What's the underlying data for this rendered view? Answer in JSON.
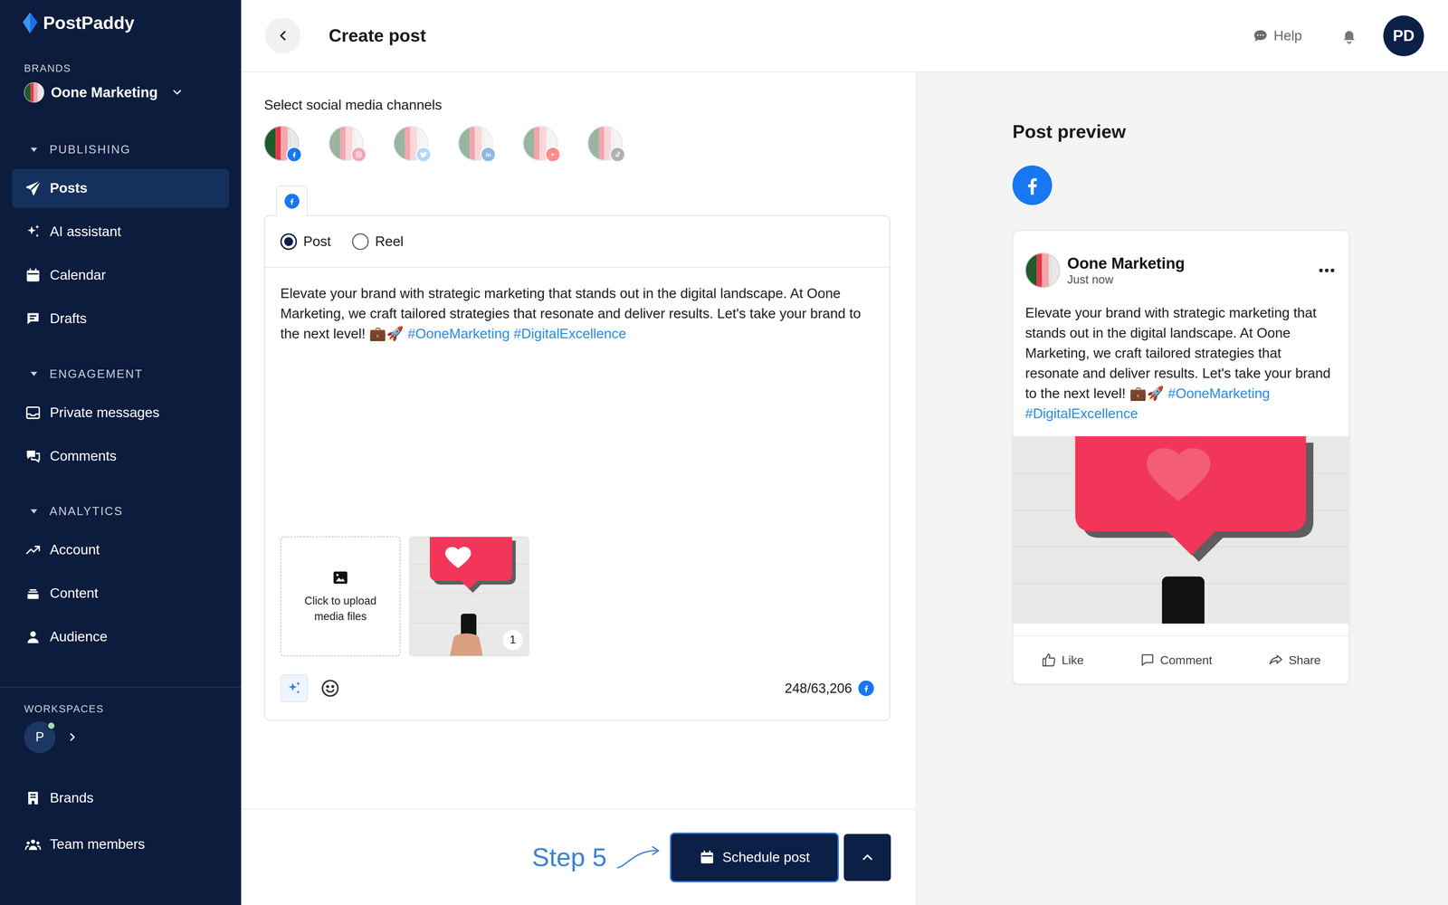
{
  "sidebar": {
    "logo": "PostPaddy",
    "brands_label": "BRANDS",
    "brand": "Oone Marketing",
    "sections": [
      {
        "title": "PUBLISHING",
        "expanded": true,
        "items": [
          {
            "label": "Posts",
            "selected": true
          },
          {
            "label": "AI assistant",
            "selected": false
          },
          {
            "label": "Calendar",
            "selected": false
          },
          {
            "label": "Drafts",
            "selected": false
          }
        ]
      },
      {
        "title": "ENGAGEMENT",
        "expanded": true,
        "items": [
          {
            "label": "Private messages",
            "selected": false
          },
          {
            "label": "Comments",
            "selected": false
          }
        ]
      },
      {
        "title": "ANALYTICS",
        "expanded": true,
        "items": [
          {
            "label": "Account",
            "selected": false
          },
          {
            "label": "Content",
            "selected": false
          },
          {
            "label": "Audience",
            "selected": false
          }
        ]
      }
    ],
    "workspaces_label": "WORKSPACES",
    "workspace": {
      "initial": "P",
      "online": true
    },
    "bottom_items": [
      {
        "label": "Brands",
        "selected": false
      },
      {
        "label": "Team members",
        "selected": false
      }
    ]
  },
  "header": {
    "title": "Create post",
    "help": "Help",
    "avatar": "PD"
  },
  "channels": {
    "label": "Select social media channels",
    "items": [
      {
        "kind": "facebook",
        "selected": true,
        "color": "#1877f2"
      },
      {
        "kind": "instagram",
        "selected": false,
        "color": "#e4405f"
      },
      {
        "kind": "twitter",
        "selected": false,
        "color": "#55acee"
      },
      {
        "kind": "linkedin",
        "selected": false,
        "color": "#0a66c2"
      },
      {
        "kind": "youtube",
        "selected": false,
        "color": "#ff0000"
      },
      {
        "kind": "tiktok",
        "selected": false,
        "color": "#555555"
      }
    ]
  },
  "editor": {
    "tabs": [
      {
        "kind": "facebook",
        "selected": true
      }
    ],
    "post_types": [
      {
        "label": "Post",
        "selected": true
      },
      {
        "label": "Reel",
        "selected": false
      }
    ],
    "text": "Elevate your brand with strategic marketing that stands out in the digital landscape. At Oone Marketing, we craft tailored strategies that resonate and deliver results. Let's take your brand to the next level! 💼🚀",
    "hashtags": [
      "#OoneMarketing",
      "#DigitalExcellence"
    ],
    "upload": "Click to upload media files",
    "media": [
      {
        "order": "1"
      }
    ],
    "char_count": "248/63,206"
  },
  "footer": {
    "step": "Step 5",
    "schedule": "Schedule post"
  },
  "preview": {
    "title": "Post preview",
    "networks": [
      {
        "kind": "facebook"
      }
    ],
    "account": "Oone Marketing",
    "time": "Just now",
    "text": "Elevate your brand with strategic marketing that stands out in the digital landscape. At Oone Marketing, we craft tailored strategies that resonate and deliver results. Let's take your brand to the next level! 💼🚀",
    "hashtags": [
      "#OoneMarketing",
      "#DigitalExcellence"
    ],
    "actions": [
      {
        "label": "Like"
      },
      {
        "label": "Comment"
      },
      {
        "label": "Share"
      }
    ]
  }
}
